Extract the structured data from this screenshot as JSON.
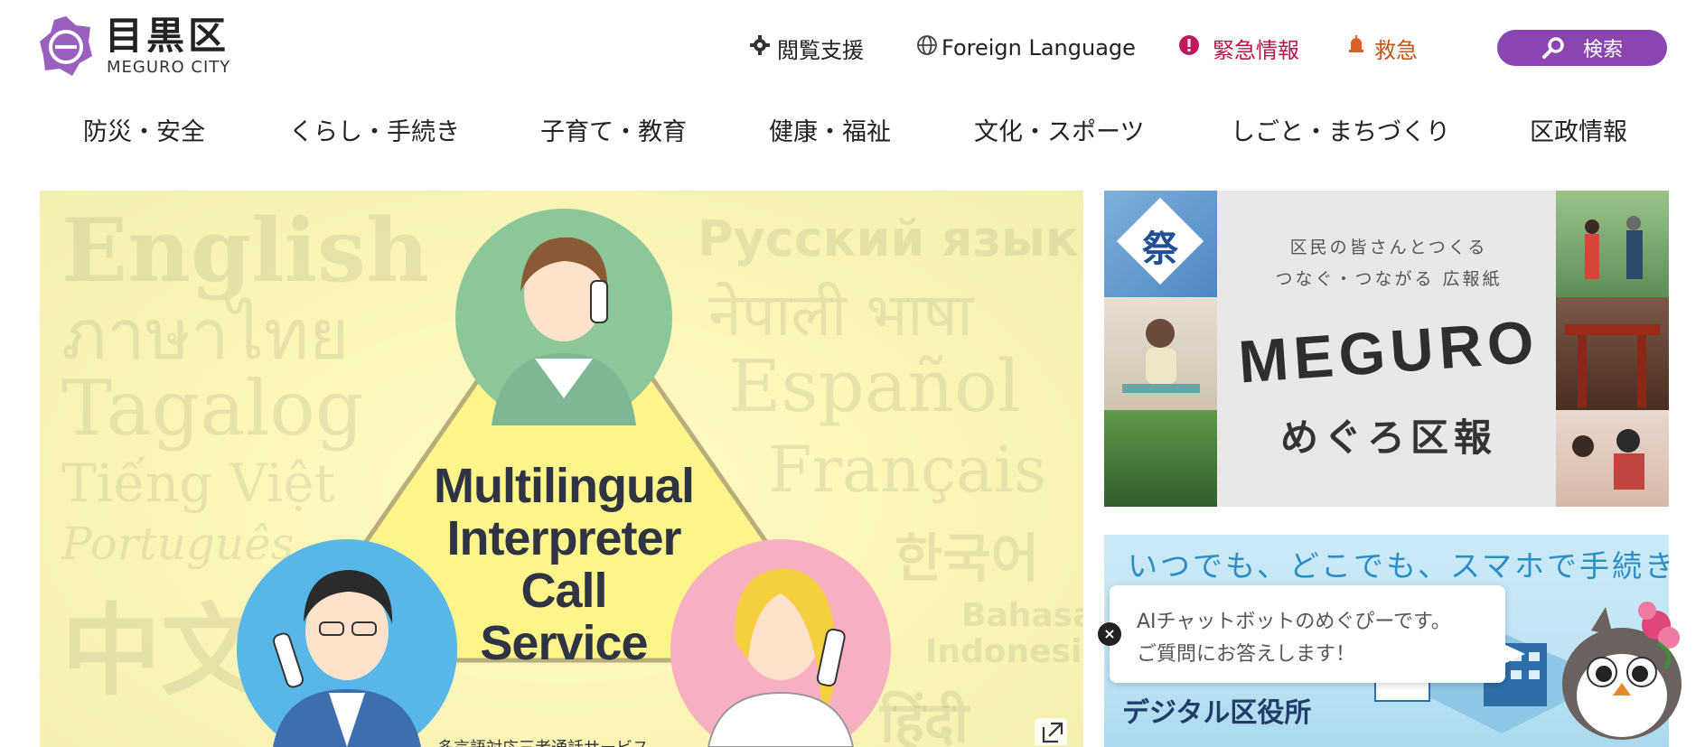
{
  "header": {
    "logo_ja": "目黒区",
    "logo_en": "MEGURO CITY",
    "utility": {
      "accessibility": "閲覧支援",
      "foreign_language": "Foreign Language",
      "emergency_info": "緊急情報",
      "ambulance": "救急"
    },
    "search_label": "検索",
    "colors": {
      "brand_purple": "#8b45b2",
      "emergency_red": "#b8164a",
      "ambulance_orange": "#c0571b"
    }
  },
  "nav": {
    "items": [
      "防災・安全",
      "くらし・手続き",
      "子育て・教育",
      "健康・福祉",
      "文化・スポーツ",
      "しごと・まちづくり",
      "区政情報"
    ]
  },
  "main_banner": {
    "title_lines": [
      "Multilingual",
      "Interpreter",
      "Call",
      "Service"
    ],
    "subtitle_partial": "多言語対応三者通話サービス",
    "background_languages": [
      "English",
      "ภาษาไทย",
      "Tagalog",
      "Tiếng Việt",
      "Português",
      "中文",
      "Русский язык",
      "नेपाली भाषा",
      "Español",
      "Français",
      "한국어",
      "Bahasa",
      "Indonesia",
      "हिंदी"
    ],
    "icon": "external-link-icon"
  },
  "kohou_banner": {
    "tagline_1": "区民の皆さんとつくる",
    "tagline_2": "つなぐ・つながる 広報紙",
    "brand": "MEGURO",
    "title": "めぐろ区報",
    "photo_badge": "祭"
  },
  "digital_banner": {
    "headline": "いつでも、どこでも、スマホで手続き",
    "label": "デジタル区役所"
  },
  "chatbot": {
    "line1": "AIチャットボットのめぐぴーです。",
    "line2": "ご質問にお答えします！",
    "close": "×"
  }
}
